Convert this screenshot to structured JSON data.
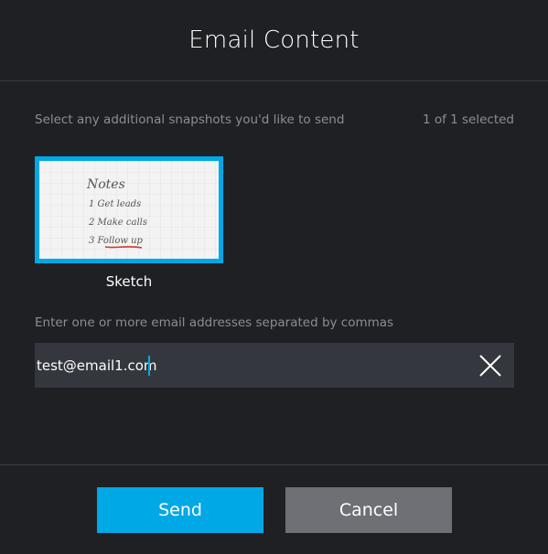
{
  "dialog": {
    "title": "Email Content"
  },
  "snapshots": {
    "hint": "Select any additional snapshots you'd like to send",
    "count_label": "1 of 1 selected",
    "items": [
      {
        "caption": "Sketch",
        "selected": true,
        "note_lines": [
          "Notes",
          "1 Get leads",
          "2 Make calls",
          "3 Follow up"
        ]
      }
    ]
  },
  "email": {
    "hint": "Enter one or more email addresses separated by commas",
    "value": "test@email1.com"
  },
  "actions": {
    "send_label": "Send",
    "cancel_label": "Cancel"
  },
  "colors": {
    "background": "#1e2024",
    "accent": "#00a8e6",
    "input_bg": "#34373d",
    "cancel_bg": "#6e7076",
    "hint_text": "#8a8e94"
  }
}
